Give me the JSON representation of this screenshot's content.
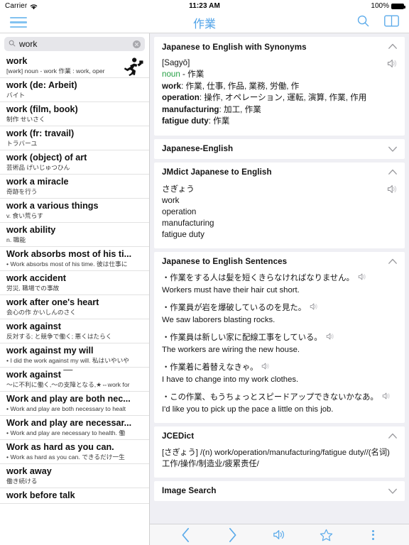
{
  "status_bar": {
    "carrier": "Carrier",
    "wifi_icon": "wifi-icon",
    "time": "11:23 AM",
    "battery_percent": "100%",
    "battery_icon": "battery-icon"
  },
  "nav_bar": {
    "menu_icon": "hamburger-menu-icon",
    "title": "作業",
    "search_icon": "search-icon",
    "split_view_icon": "book-split-view-icon"
  },
  "colors": {
    "accent": "#4ea2e8",
    "tint_light": "#82c2f0",
    "pane_background": "#efeff4",
    "pos_green": "#26a045"
  },
  "search": {
    "value": "work",
    "placeholder": "Search",
    "search_icon": "search-icon",
    "clear_icon": "clear-circle-icon"
  },
  "results": [
    {
      "title": "work",
      "sub": "[wərk] noun  - work 作業 : work, oper",
      "bullet": false,
      "icon": "running-man-icon"
    },
    {
      "title": "work (de: Arbeit)",
      "sub": "バイト",
      "bullet": false
    },
    {
      "title": "work (film, book)",
      "sub": "制作 せいさく",
      "bullet": false
    },
    {
      "title": "work (fr: travail)",
      "sub": "トラバーユ",
      "bullet": false
    },
    {
      "title": "work (object) of art",
      "sub": "芸術品 げいじゅつひん",
      "bullet": false
    },
    {
      "title": "work a miracle",
      "sub": "奇跡を行う",
      "bullet": false
    },
    {
      "title": "work a various things",
      "sub": "v. 食い荒らす",
      "bullet": false
    },
    {
      "title": "work ability",
      "sub": "n. 職能",
      "bullet": false
    },
    {
      "title": "Work absorbs most of his ti...",
      "sub": "Work absorbs most of his time. 彼は仕事に",
      "bullet": true
    },
    {
      "title": "work accident",
      "sub": "労災, 職場での事故",
      "bullet": false
    },
    {
      "title": "work after one's heart",
      "sub": "会心の作 かいしんのさく",
      "bullet": false
    },
    {
      "title": "work against",
      "sub": "反対する; と競争で働く; 悪くはたらく",
      "bullet": false
    },
    {
      "title": "work against my will",
      "sub": "I did the work against my will. 私はいやいや",
      "bullet": true
    },
    {
      "title": "work against ￣",
      "sub": "〜に不利に働く,〜の支障となる,★⇔work for",
      "bullet": false
    },
    {
      "title": "Work and play are both nec...",
      "sub": "Work and play are both necessary to healt",
      "bullet": true
    },
    {
      "title": "Work and play are necessar...",
      "sub": "Work and play are necessary to health. 働",
      "bullet": true
    },
    {
      "title": "Work as hard as you can.",
      "sub": "Work as hard as you can. できるだけ一生",
      "bullet": true
    },
    {
      "title": "work away",
      "sub": "働き続ける",
      "bullet": false
    },
    {
      "title": "work before talk",
      "sub": "",
      "bullet": false
    }
  ],
  "sections": [
    {
      "title": "Japanese to English with Synonyms",
      "expanded": true,
      "chevron": "chevron-up-icon",
      "speaker_icon": "speaker-icon",
      "romaji": "[Sagyō]",
      "pos": "noun",
      "headword": "- 作業",
      "synonyms": [
        {
          "label": "work",
          "values": "作業, 仕事, 作品, 業務, 労働, 作"
        },
        {
          "label": "operation",
          "values": "操作, オペレーション, 運転, 演算, 作業, 作用"
        },
        {
          "label": "manufacturing",
          "values": "加工, 作業"
        },
        {
          "label": "fatigue duty",
          "values": "作業"
        }
      ]
    },
    {
      "title": "Japanese-English",
      "expanded": false,
      "chevron": "chevron-down-icon"
    },
    {
      "title": "JMdict Japanese to English",
      "expanded": true,
      "chevron": "chevron-up-icon",
      "speaker_icon": "speaker-icon",
      "kana": "さぎょう",
      "glosses": [
        "work",
        "operation",
        "manufacturing",
        "fatigue duty"
      ]
    },
    {
      "title": "Japanese to English Sentences",
      "expanded": true,
      "chevron": "chevron-up-icon",
      "sentences": [
        {
          "ja": "・作業をする人は髪を短くきらなければなりません。",
          "en": "Workers must have their hair cut short.",
          "speaker_icon": "speaker-icon"
        },
        {
          "ja": "・作業員が岩を爆破しているのを見た。",
          "en": "We saw laborers blasting rocks.",
          "speaker_icon": "speaker-icon"
        },
        {
          "ja": "・作業員は新しい家に配線工事をしている。",
          "en": "The workers are wiring the new house.",
          "speaker_icon": "speaker-icon"
        },
        {
          "ja": "・作業着に着替えなきゃ。",
          "en": "I have to change into my work clothes.",
          "speaker_icon": "speaker-icon"
        },
        {
          "ja": "・この作業、もうちょっとスピードアップできないかなあ。",
          "en": "I'd like you to pick up the pace a little on this job.",
          "speaker_icon": "speaker-icon"
        }
      ]
    },
    {
      "title": "JCEDict",
      "expanded": true,
      "chevron": "chevron-up-icon",
      "text": "[さぎょう] /(n) work/operation/manufacturing/fatigue duty//(名词)工作/操作/制造业/疲累责任/"
    },
    {
      "title": "Image Search",
      "expanded": false,
      "chevron": "chevron-down-icon"
    }
  ],
  "toolbar": {
    "back_icon": "chevron-left-back-icon",
    "forward_icon": "chevron-right-forward-icon",
    "speaker_icon": "speaker-icon",
    "favorite_icon": "star-outline-icon",
    "more_icon": "more-vertical-dots-icon"
  }
}
